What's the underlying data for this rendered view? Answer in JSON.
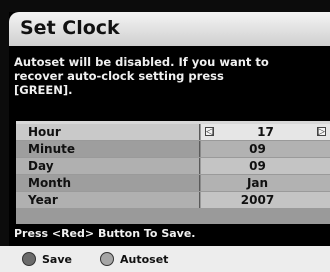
{
  "dialog": {
    "title": "Set Clock",
    "message_lines": [
      "Autoset will be disabled. If you want to",
      "recover auto-clock setting press",
      "[GREEN]."
    ]
  },
  "settings": [
    {
      "label": "Hour",
      "value": "17"
    },
    {
      "label": "Minute",
      "value": "09"
    },
    {
      "label": "Day",
      "value": "09"
    },
    {
      "label": "Month",
      "value": "Jan"
    },
    {
      "label": "Year",
      "value": "2007"
    }
  ],
  "hint": "Press <Red> Button To Save.",
  "footer": {
    "save_label": "Save",
    "autoset_label": "Autoset"
  },
  "colors": {
    "red_button": "#6b6b6b",
    "green_button": "#a6a6a6"
  },
  "icons": {
    "prev": "◁",
    "next": "▷"
  }
}
